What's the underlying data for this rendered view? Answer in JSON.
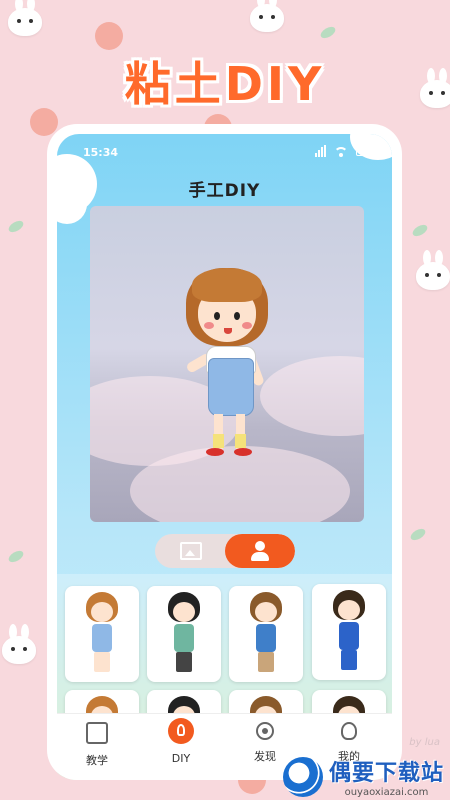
{
  "promo": {
    "title": "粘土DIY"
  },
  "status_bar": {
    "time": "15:34"
  },
  "page": {
    "title": "手工DIY"
  },
  "toggle": {
    "left_icon": "image-icon",
    "right_icon": "person-icon",
    "active": "right"
  },
  "character_grid": {
    "cards": [
      {
        "name": "girl-blue-dress",
        "hair": "#c47a35",
        "body": "#8fb8e6",
        "legs": "#fde3cf"
      },
      {
        "name": "boy-green-shirt",
        "hair": "#222222",
        "body": "#6fb6a0",
        "legs": "#444444"
      },
      {
        "name": "boy-brown-hair-running",
        "hair": "#8a5a2b",
        "body": "#3f7fc9",
        "legs": "#c9a57a"
      },
      {
        "name": "boy-glasses-blue-shirt",
        "hair": "#3a2a1a",
        "body": "#2c63c9",
        "legs": "#2c63c9"
      },
      {
        "name": "girl-partial",
        "hair": "#c47a35",
        "body": "#ffffff",
        "legs": "#fde3cf"
      },
      {
        "name": "boy-partial",
        "hair": "#222222",
        "body": "#ffffff",
        "legs": "#ffffff"
      },
      {
        "name": "boy-partial-2",
        "hair": "#8a5a2b",
        "body": "#ffffff",
        "legs": "#ffffff"
      },
      {
        "name": "boy-partial-3",
        "hair": "#3a2a1a",
        "body": "#ffffff",
        "legs": "#ffffff"
      }
    ]
  },
  "tabs": [
    {
      "label": "教学",
      "icon": "teach-icon"
    },
    {
      "label": "DIY",
      "icon": "diy-icon",
      "active": true
    },
    {
      "label": "发现",
      "icon": "discover-icon"
    },
    {
      "label": "我的",
      "icon": "profile-icon"
    }
  ],
  "watermark": {
    "cn": "偶要下载站",
    "en": "ouyaoxiazai.com",
    "signature": "by lua"
  },
  "colors": {
    "accent": "#f25a1f",
    "title_orange": "#ff6a2b",
    "bg_pink": "#f8d9dd"
  }
}
